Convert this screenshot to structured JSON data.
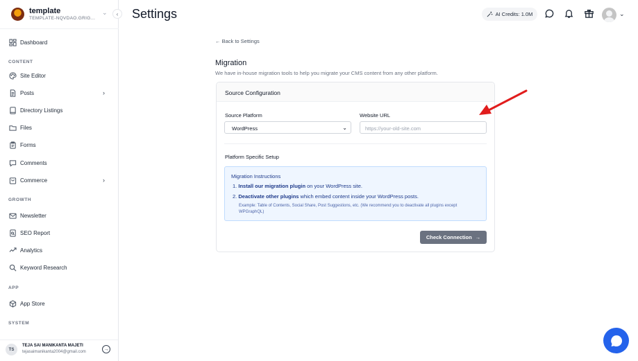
{
  "workspace": {
    "name": "template",
    "subdomain": "TEMPLATE-NQVDAO.GRIGOR..."
  },
  "sidebar": {
    "items": [
      {
        "label": "Dashboard",
        "icon": "dashboard-icon"
      },
      {
        "label": "Site Editor",
        "icon": "palette-icon"
      },
      {
        "label": "Posts",
        "icon": "document-icon"
      },
      {
        "label": "Directory Listings",
        "icon": "book-icon"
      },
      {
        "label": "Files",
        "icon": "folder-icon"
      },
      {
        "label": "Forms",
        "icon": "clipboard-icon"
      },
      {
        "label": "Comments",
        "icon": "comment-icon"
      },
      {
        "label": "Commerce",
        "icon": "shopping-bag-icon"
      },
      {
        "label": "Newsletter",
        "icon": "mail-icon"
      },
      {
        "label": "SEO Report",
        "icon": "seo-report-icon"
      },
      {
        "label": "Analytics",
        "icon": "analytics-icon"
      },
      {
        "label": "Keyword Research",
        "icon": "search-icon"
      },
      {
        "label": "App Store",
        "icon": "cube-icon"
      }
    ],
    "sections": {
      "content": "CONTENT",
      "growth": "GROWTH",
      "app": "APP",
      "system": "SYSTEM"
    },
    "user": {
      "initials": "TS",
      "name": "TEJA SAI MANIKANTA MAJETI",
      "email": "tejasaimanikanta2004@gmail.com"
    }
  },
  "header": {
    "title": "Settings",
    "credits": "AI Credits: 1.0M"
  },
  "main": {
    "back_link": "← Back to Settings",
    "section_title": "Migration",
    "section_desc": "We have in-house migration tools to help you migrate your CMS content from any other platform.",
    "card": {
      "title": "Source Configuration",
      "platform_label": "Source Platform",
      "platform_value": "WordPress",
      "url_label": "Website URL",
      "url_placeholder": "https://your-old-site.com",
      "setup_title": "Platform Specific Setup",
      "instructions": {
        "title": "Migration Instructions",
        "step1_num": "1.",
        "step1_bold": "Install our migration plugin",
        "step1_rest": " on your WordPress site.",
        "step2_num": "2.",
        "step2_bold": "Deactivate other plugins",
        "step2_rest": " which embed content inside your WordPress posts.",
        "note": "Example: Table of Contents, Social Share, Post Suggestions, etc. (We recommend you to deactivate all plugins except WPGraphQL)"
      },
      "button": "Check Connection"
    }
  },
  "colors": {
    "accent": "#2563eb",
    "button_bg": "#6b7280",
    "annotation_arrow": "#e11d1d",
    "info_bg": "#eff6ff"
  }
}
